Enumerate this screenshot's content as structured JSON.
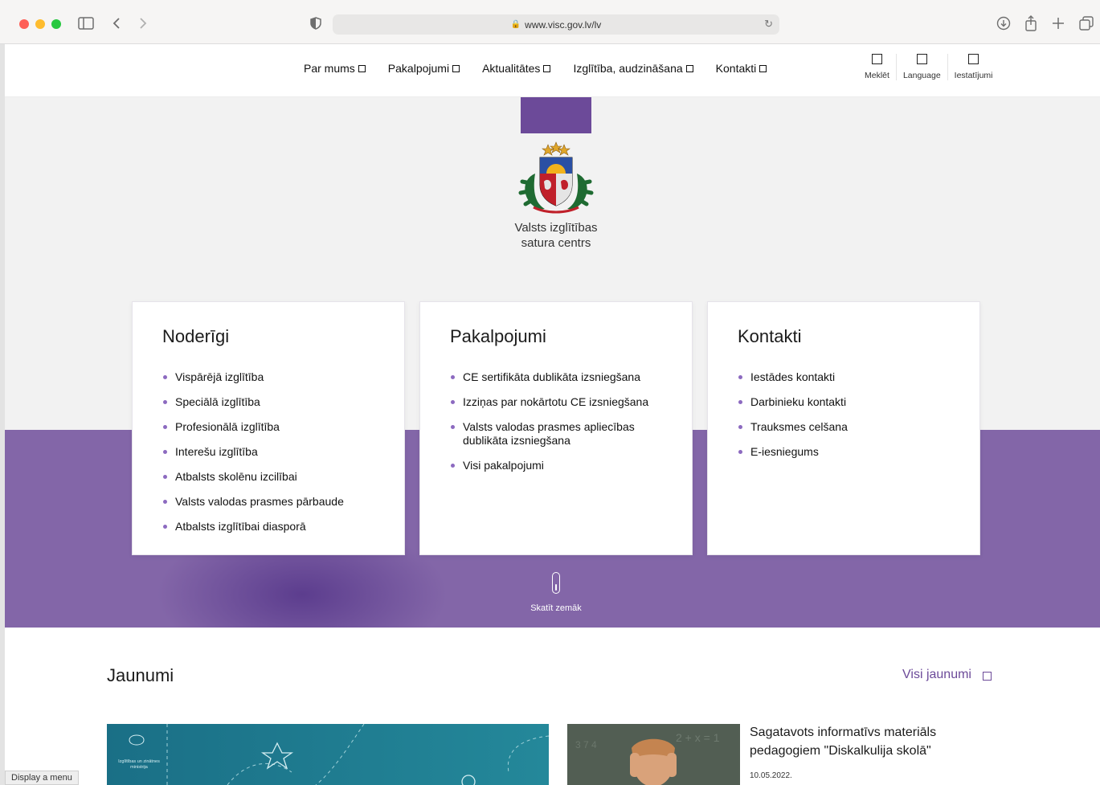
{
  "browser": {
    "url": "www.visc.gov.lv/lv"
  },
  "header": {
    "nav": [
      {
        "label": "Par mums"
      },
      {
        "label": "Pakalpojumi"
      },
      {
        "label": "Aktualitātes"
      },
      {
        "label": "Izglītība, audzināšana"
      },
      {
        "label": "Kontakti"
      }
    ],
    "tools": [
      {
        "label": "Meklēt",
        "icon": "square-icon"
      },
      {
        "label": "Language",
        "icon": "square-icon"
      },
      {
        "label": "Iestatījumi",
        "icon": "square-icon"
      }
    ]
  },
  "hero": {
    "org_name_line1": "Valsts izglītības",
    "org_name_line2": "satura centrs",
    "scroll_label": "Skatīt zemāk"
  },
  "cards": [
    {
      "title": "Noderīgi",
      "items": [
        "Vispārējā izglītība",
        "Speciālā izglītība",
        "Profesionālā izglītība",
        "Interešu izglītība",
        "Atbalsts skolēnu izcilībai",
        "Valsts valodas prasmes pārbaude",
        "Atbalsts izglītībai diasporā"
      ]
    },
    {
      "title": "Pakalpojumi",
      "items": [
        "CE sertifikāta dublikāta izsniegšana",
        "Izziņas par nokārtotu CE izsniegšana",
        "Valsts valodas prasmes apliecības dublikāta izsniegšana",
        "Visi pakalpojumi"
      ]
    },
    {
      "title": "Kontakti",
      "items": [
        "Iestādes kontakti",
        "Darbinieku kontakti",
        "Trauksmes celšana",
        "E-iesniegums"
      ]
    }
  ],
  "news": {
    "title": "Jaunumi",
    "all_link": "Visi jaunumi",
    "image1_caption": "Izglītības un zinātnes ministrija",
    "item": {
      "headline": "Sagatavots informatīvs materiāls pedagogiem \"Diskalkulija skolā\"",
      "date": "10.05.2022."
    }
  },
  "status_bar": "Display a menu",
  "colors": {
    "brand_purple": "#6c4a99",
    "band_purple": "#8366a8",
    "bullet": "#8c6ac0"
  }
}
